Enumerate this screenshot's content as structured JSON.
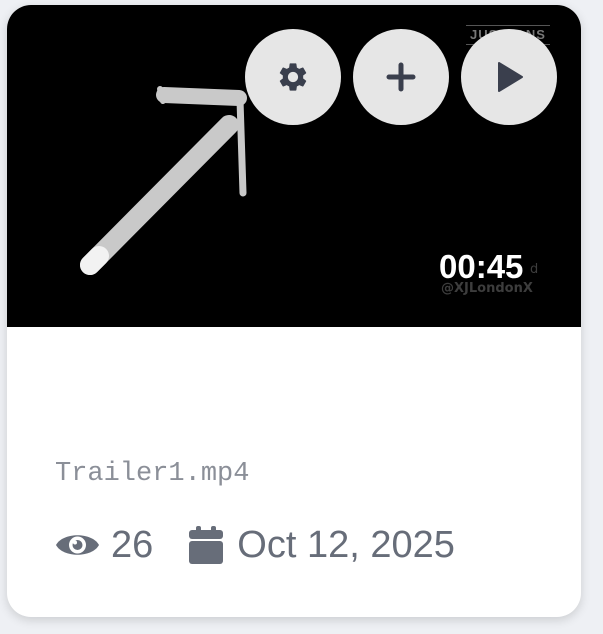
{
  "video": {
    "duration": "00:45",
    "watermark_top": "JUSTFANS",
    "watermark_bottom": "@XJLondonX",
    "watermark_tail": "d"
  },
  "controls": {
    "settings_icon": "gear-icon",
    "add_icon": "plus-icon",
    "play_icon": "play-icon"
  },
  "info": {
    "filename": "Trailer1.mp4",
    "views": "26",
    "date": "Oct 12, 2025",
    "views_icon": "eye-icon",
    "date_icon": "calendar-icon"
  },
  "colors": {
    "thumbnail_bg": "#000000",
    "control_bg": "#e6e6e6",
    "control_icon": "#3a3f4d",
    "meta_text": "#676d79",
    "filename_text": "#8b8f98"
  }
}
